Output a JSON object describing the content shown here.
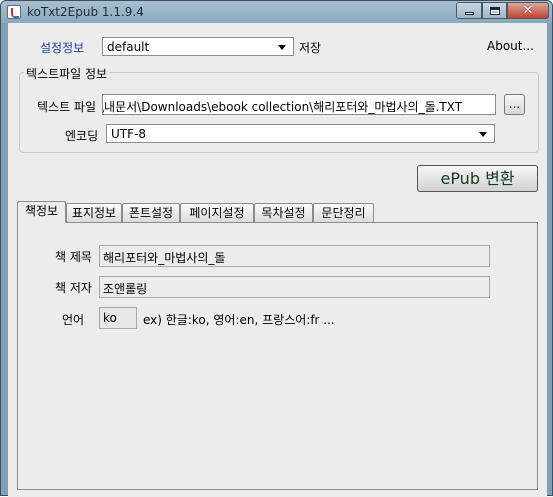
{
  "window": {
    "title": "koTxt2Epub 1.1.9.4"
  },
  "settings": {
    "label": "설정정보",
    "selected": "default",
    "save_label": "저장",
    "about_label": "About..."
  },
  "text_file": {
    "group_title": "텍스트파일 정보",
    "file_label": "텍스트 파일",
    "file_path": "\\내문서\\Downloads\\ebook collection\\해리포터와_마법사의_돌.TXT",
    "browse_label": "...",
    "encoding_label": "엔코딩",
    "encoding_value": "UTF-8"
  },
  "convert_button": "ePub 변환",
  "tabs": [
    {
      "label": "책정보",
      "active": true
    },
    {
      "label": "표지정보",
      "active": false
    },
    {
      "label": "폰트설정",
      "active": false
    },
    {
      "label": "페이지설정",
      "active": false
    },
    {
      "label": "목차설정",
      "active": false
    },
    {
      "label": "문단정리",
      "active": false
    }
  ],
  "book_info": {
    "title_label": "책 제목",
    "title_value": "해리포터와_마법사의_돌",
    "author_label": "책 저자",
    "author_value": "조앤롤링",
    "language_label": "언어",
    "language_value": "ko",
    "language_hint": "ex) 한글:ko, 영어:en, 프랑스어:fr ..."
  },
  "colors": {
    "titlebar": "#8aa9bd",
    "label_blue": "#1a3fa8",
    "panel_bg": "#ececec"
  }
}
